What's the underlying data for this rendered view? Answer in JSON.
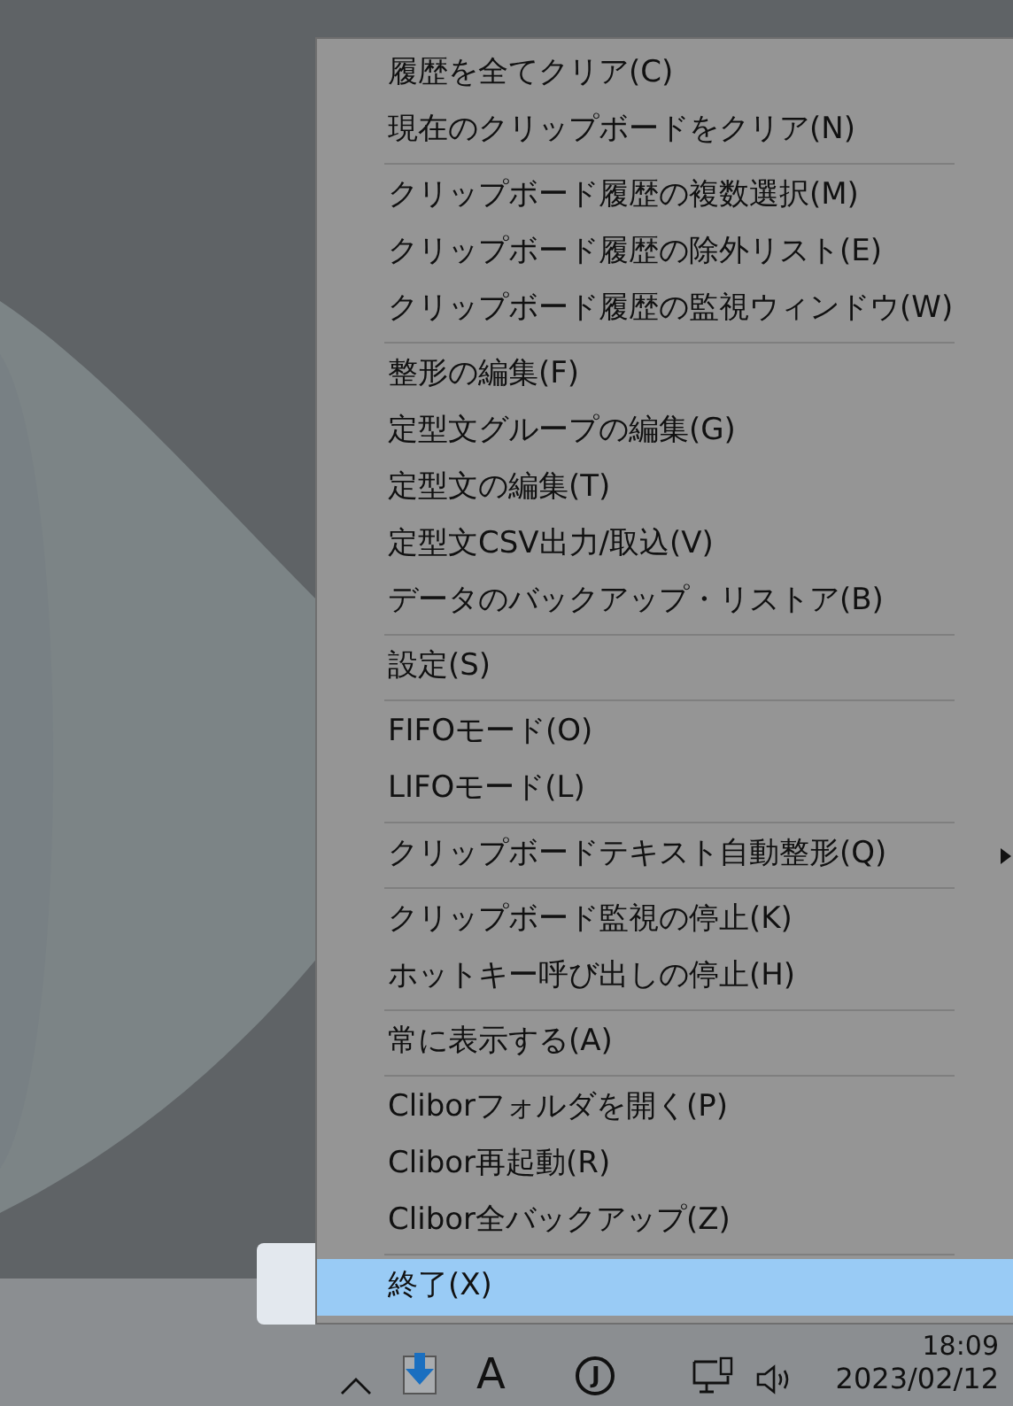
{
  "menu": {
    "items": [
      {
        "kind": "item",
        "label": "履歴を全てクリア(C)",
        "selected": false
      },
      {
        "kind": "item",
        "label": "現在のクリップボードをクリア(N)",
        "selected": false
      },
      {
        "kind": "separator"
      },
      {
        "kind": "item",
        "label": "クリップボード履歴の複数選択(M)",
        "selected": false
      },
      {
        "kind": "item",
        "label": "クリップボード履歴の除外リスト(E)",
        "selected": false
      },
      {
        "kind": "item",
        "label": "クリップボード履歴の監視ウィンドウ(W)",
        "selected": false
      },
      {
        "kind": "separator"
      },
      {
        "kind": "item",
        "label": "整形の編集(F)",
        "selected": false
      },
      {
        "kind": "item",
        "label": "定型文グループの編集(G)",
        "selected": false
      },
      {
        "kind": "item",
        "label": "定型文の編集(T)",
        "selected": false
      },
      {
        "kind": "item",
        "label": "定型文CSV出力/取込(V)",
        "selected": false
      },
      {
        "kind": "item",
        "label": "データのバックアップ・リストア(B)",
        "selected": false
      },
      {
        "kind": "separator"
      },
      {
        "kind": "item",
        "label": "設定(S)",
        "selected": false
      },
      {
        "kind": "separator"
      },
      {
        "kind": "item",
        "label": "FIFOモード(O)",
        "selected": false
      },
      {
        "kind": "item",
        "label": "LIFOモード(L)",
        "selected": false
      },
      {
        "kind": "separator"
      },
      {
        "kind": "submenu",
        "label": "クリップボードテキスト自動整形(Q)",
        "selected": false
      },
      {
        "kind": "separator"
      },
      {
        "kind": "item",
        "label": "クリップボード監視の停止(K)",
        "selected": false
      },
      {
        "kind": "item",
        "label": "ホットキー呼び出しの停止(H)",
        "selected": false
      },
      {
        "kind": "separator"
      },
      {
        "kind": "item",
        "label": "常に表示する(A)",
        "selected": false
      },
      {
        "kind": "separator"
      },
      {
        "kind": "item",
        "label": "Cliborフォルダを開く(P)",
        "selected": false
      },
      {
        "kind": "item",
        "label": "Clibor再起動(R)",
        "selected": false
      },
      {
        "kind": "item",
        "label": "Clibor全バックアップ(Z)",
        "selected": false
      },
      {
        "kind": "separator"
      },
      {
        "kind": "item",
        "label": "終了(X)",
        "selected": true
      }
    ]
  },
  "taskbar": {
    "ime_mode": "A",
    "ime_indicator": "J",
    "time": "18:09",
    "date": "2023/02/12"
  }
}
